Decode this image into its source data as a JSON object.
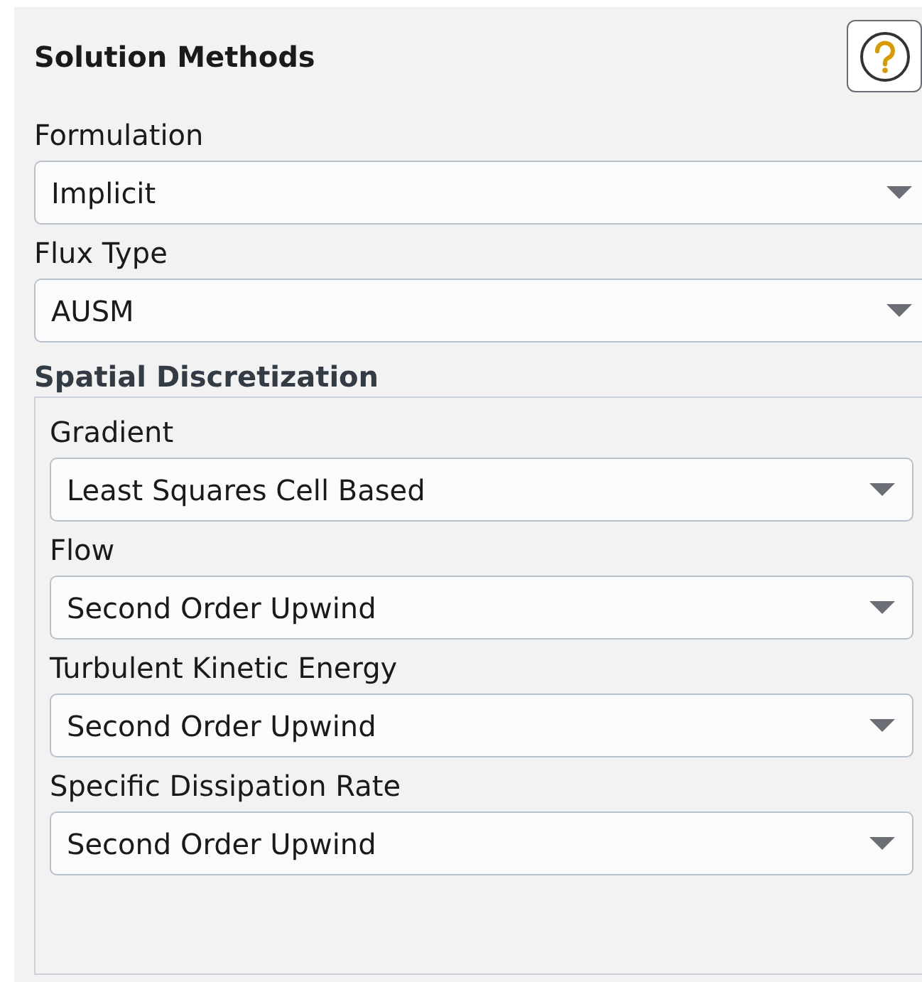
{
  "panel": {
    "title": "Solution Methods"
  },
  "fields": [
    {
      "label": "Formulation",
      "value": "Implicit"
    },
    {
      "label": "Flux Type",
      "value": "AUSM"
    }
  ],
  "spatial_discretization": {
    "heading": "Spatial Discretization",
    "fields": [
      {
        "label": "Gradient",
        "value": "Least Squares Cell Based"
      },
      {
        "label": "Flow",
        "value": "Second Order Upwind"
      },
      {
        "label": "Turbulent Kinetic Energy",
        "value": "Second Order Upwind"
      },
      {
        "label": "Specific Dissipation Rate",
        "value": "Second Order Upwind"
      }
    ]
  }
}
